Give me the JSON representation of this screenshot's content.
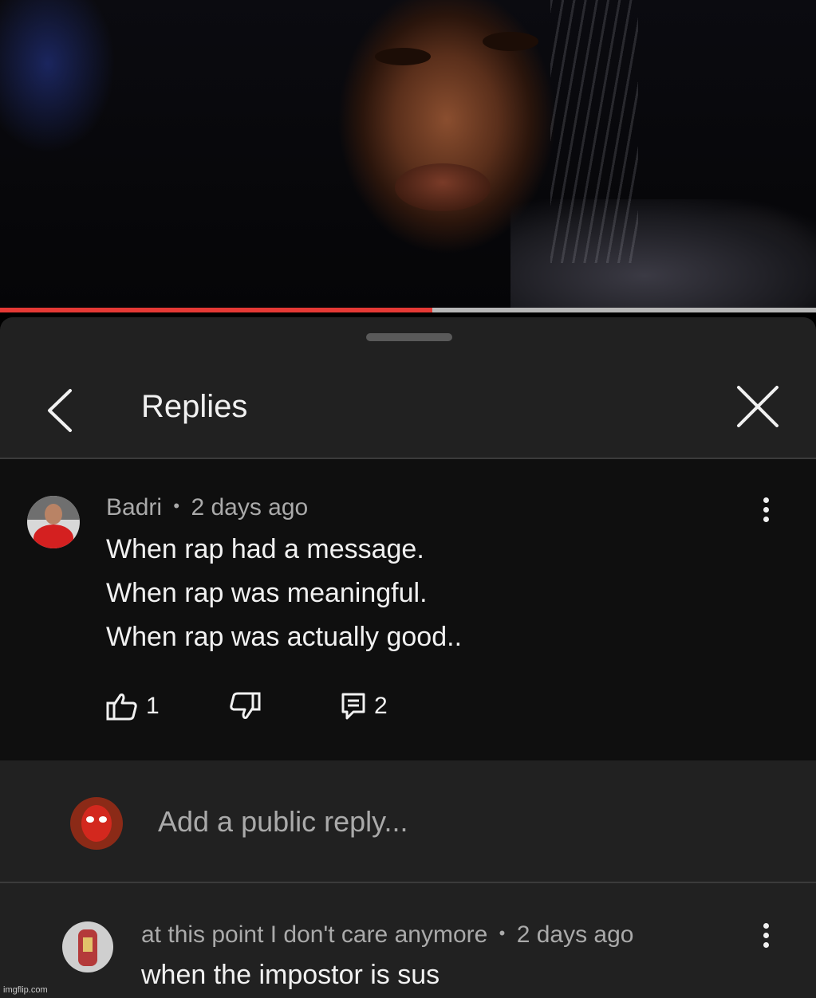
{
  "player": {
    "progress_fraction": 0.53,
    "progress_color": "#e53935"
  },
  "header": {
    "title": "Replies",
    "back_icon": "chevron-left-icon",
    "close_icon": "close-icon"
  },
  "comment": {
    "author": "Badri",
    "separator": "•",
    "time": "2 days ago",
    "lines": [
      "When rap had a message.",
      "When rap was meaningful.",
      "When rap was actually good.."
    ],
    "likes": "1",
    "replies": "2"
  },
  "reply_box": {
    "placeholder": "Add a public reply..."
  },
  "replies": [
    {
      "author": "at this point I don't care anymore",
      "separator": "•",
      "time": "2 days ago",
      "text": "when the impostor is sus"
    }
  ],
  "watermark": "imgflip.com",
  "colors": {
    "panel_bg": "#212121",
    "comment_bg": "#0f0f0f",
    "meta_text": "#aaaaaa",
    "primary_text": "#f1f1f1"
  }
}
